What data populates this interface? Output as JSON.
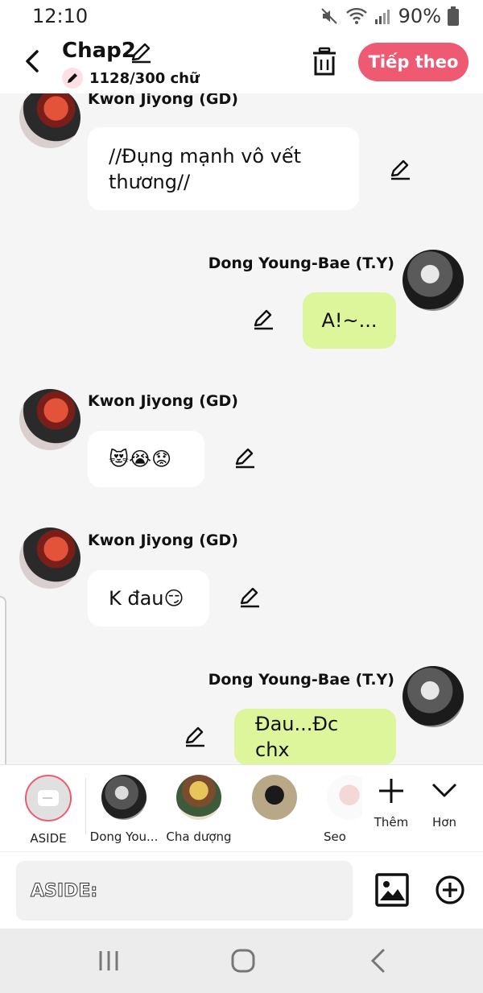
{
  "status_bar": {
    "time": "12:10",
    "battery": "90%",
    "icons": [
      "mute-icon",
      "wifi-icon",
      "signal-icon",
      "battery-icon"
    ]
  },
  "header": {
    "title": "Chap2",
    "word_count": "1128/300 chữ",
    "next_label": "Tiếp theo",
    "accent_color": "#ef5a73"
  },
  "messages": [
    {
      "side": "left",
      "sender": "Kwon Jiyong (GD)",
      "text_lines": [
        "//Đụng mạnh vô vết",
        "thương//"
      ]
    },
    {
      "side": "right",
      "sender": "Dong Young-Bae (T.Y)",
      "text": "A!~..."
    },
    {
      "side": "left",
      "sender": "Kwon Jiyong (GD)",
      "text": "😻😭😟"
    },
    {
      "side": "left",
      "sender": "Kwon Jiyong (GD)",
      "text": "K đau😏"
    },
    {
      "side": "right",
      "sender": "Dong Young-Bae (T.Y)",
      "text": "Đau...Đc chx"
    }
  ],
  "characters": [
    {
      "label": "ASIDE"
    },
    {
      "label": "Dong You..."
    },
    {
      "label": "Cha dượng"
    },
    {
      "label": ""
    },
    {
      "label": "Seo"
    }
  ],
  "tools": {
    "add_label": "Thêm",
    "more_label": "Hơn"
  },
  "input": {
    "text": "ASIDE:"
  },
  "colors": {
    "bubble_right": "#ddf59b",
    "bubble_left": "#ffffff",
    "background": "#f5f5f5"
  }
}
